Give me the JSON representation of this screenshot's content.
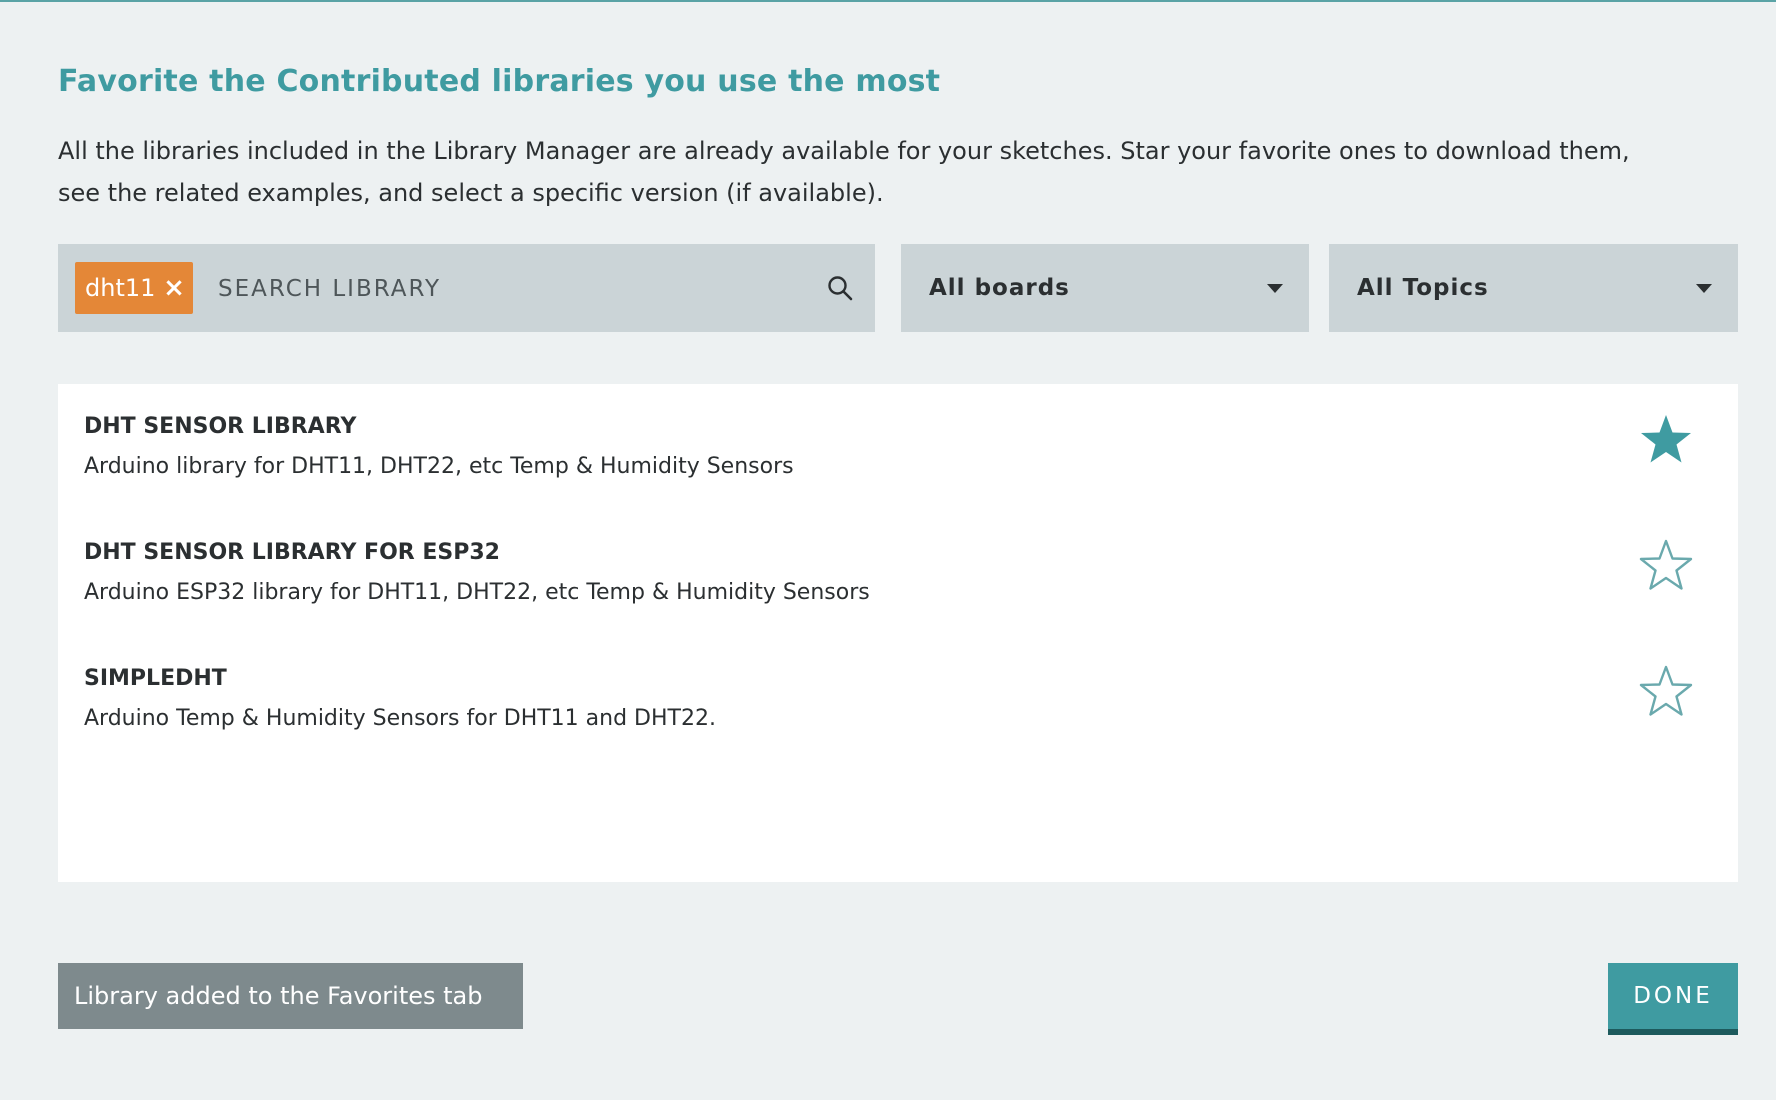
{
  "dialog": {
    "title": "Favorite the Contributed libraries you use the most",
    "description_lines": [
      "All the libraries included in the Library Manager are already available for your sketches. Star your favorite ones to download them,",
      "see the related examples, and select a specific version (if available)."
    ]
  },
  "search": {
    "chip_label": "dht11",
    "chip_remove": "×",
    "placeholder": "SEARCH LIBRARY",
    "icon": "search-icon"
  },
  "filters": {
    "boards": "All boards",
    "topics": "All Topics"
  },
  "results": [
    {
      "title": "DHT SENSOR LIBRARY",
      "description": "Arduino library for DHT11, DHT22, etc Temp & Humidity Sensors",
      "favorited": true
    },
    {
      "title": "DHT SENSOR LIBRARY FOR ESP32",
      "description": "Arduino ESP32 library for DHT11, DHT22, etc Temp & Humidity Sensors",
      "favorited": false
    },
    {
      "title": "SIMPLEDHT",
      "description": "Arduino Temp & Humidity Sensors for DHT11 and DHT22.",
      "favorited": false
    }
  ],
  "toast": {
    "message": "Library added to the Favorites tab"
  },
  "actions": {
    "done_label": "DONE"
  },
  "colors": {
    "accent": "#3f9ba1",
    "chip": "#e48737",
    "background": "#edf1f2",
    "field": "#cbd4d7",
    "toast": "#7e8a8d"
  }
}
